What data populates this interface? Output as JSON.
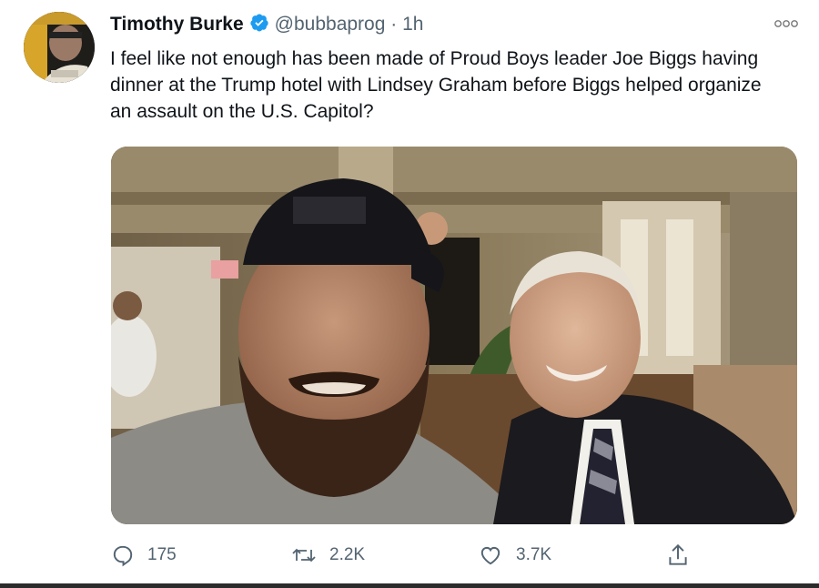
{
  "tweet": {
    "author_name": "Timothy Burke",
    "handle": "@bubbaprog",
    "separator": "·",
    "time": "1h",
    "text": "I feel like not enough has been made of Proud Boys leader Joe Biggs having dinner at the Trump hotel with Lindsey Graham  before Biggs helped organize an assault on the U.S. Capitol?",
    "verified_icon": "verified-badge-icon",
    "accent_color": "#1d9bf0",
    "actions": {
      "replies": "175",
      "retweets": "2.2K",
      "likes": "3.7K"
    }
  }
}
